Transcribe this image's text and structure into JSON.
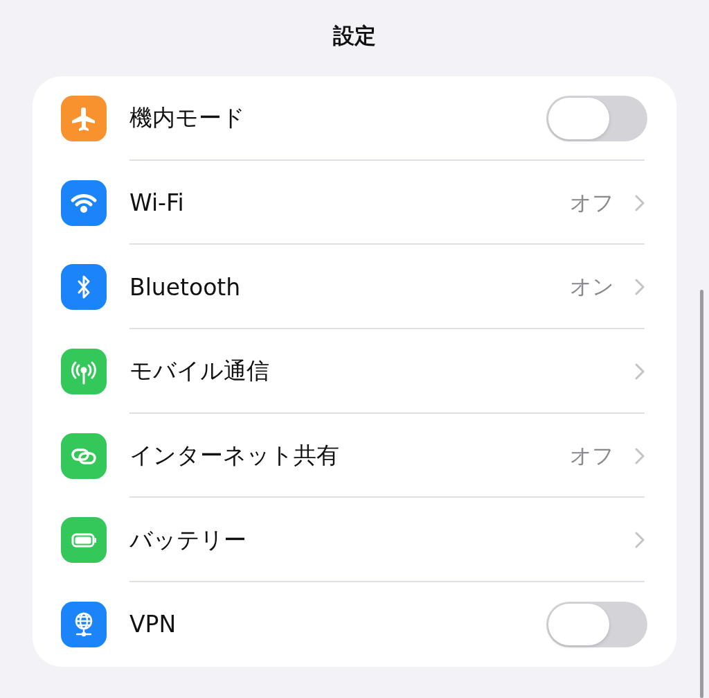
{
  "title": "設定",
  "rows": [
    {
      "kind": "toggle",
      "label": "機内モード",
      "color": "#f7922f",
      "on": false
    },
    {
      "kind": "link",
      "label": "Wi-Fi",
      "value": "オフ",
      "color": "#1a84f8"
    },
    {
      "kind": "link",
      "label": "Bluetooth",
      "value": "オン",
      "color": "#1a84f8"
    },
    {
      "kind": "link",
      "label": "モバイル通信",
      "color": "#34c759"
    },
    {
      "kind": "link",
      "label": "インターネット共有",
      "value": "オフ",
      "color": "#34c759"
    },
    {
      "kind": "link",
      "label": "バッテリー",
      "color": "#34c759"
    },
    {
      "kind": "toggle",
      "label": "VPN",
      "color": "#1a84f8",
      "on": false
    }
  ]
}
